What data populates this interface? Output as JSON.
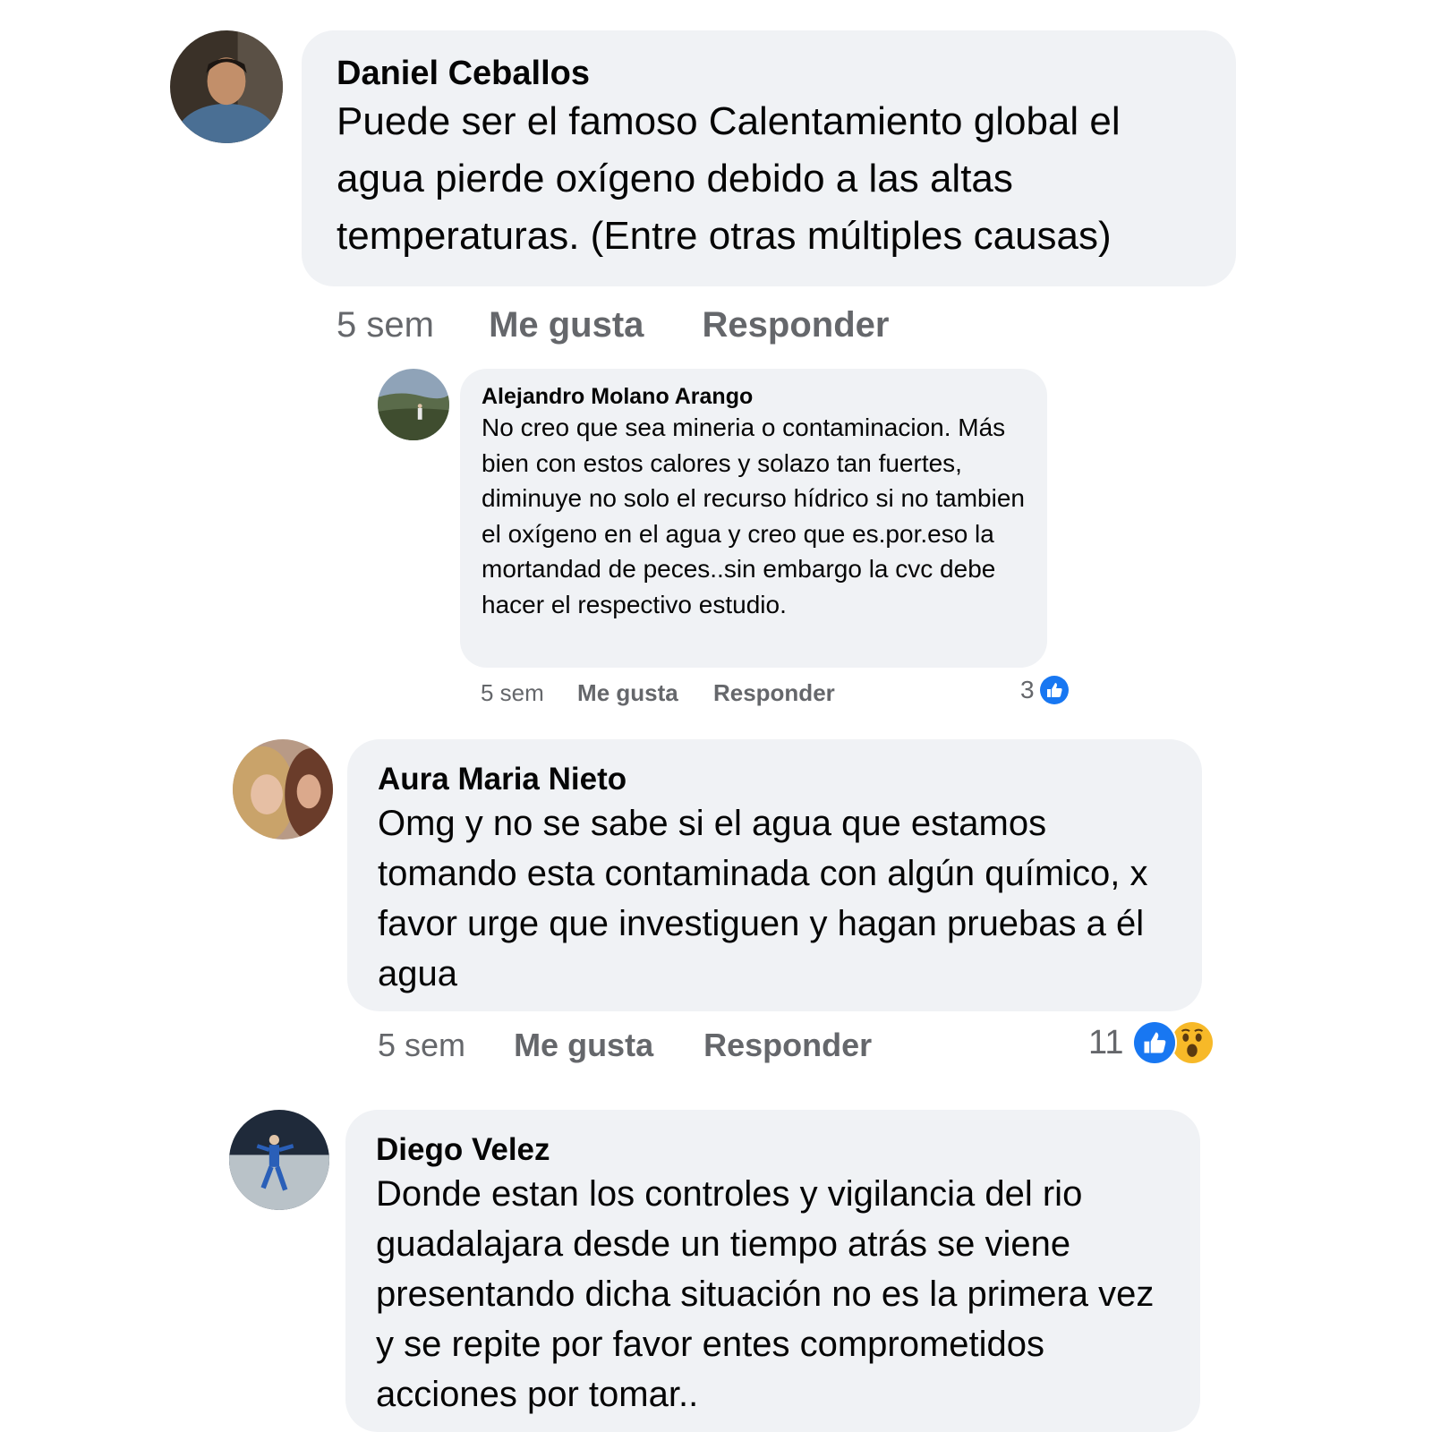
{
  "comments": [
    {
      "author": "Daniel Ceballos",
      "text": "Puede ser el famoso Calentamiento global el agua pierde oxígeno debido a las altas temperaturas. (Entre otras múltiples causas)",
      "time": "5 sem",
      "like_label": "Me gusta",
      "reply_label": "Responder",
      "avatar_icon": "profile-photo"
    },
    {
      "author": "Alejandro Molano Arango",
      "text": "No creo que sea mineria o contaminacion. Más bien con estos calores y solazo tan fuertes, diminuye no solo el recurso hídrico si no tambien el oxígeno en el agua y creo que es.por.eso la mortandad de peces..sin embargo la cvc debe hacer el respectivo estudio.",
      "time": "5 sem",
      "like_label": "Me gusta",
      "reply_label": "Responder",
      "reaction_count": "3",
      "reactions": [
        "like"
      ],
      "avatar_icon": "profile-photo-landscape"
    },
    {
      "author": "Aura Maria Nieto",
      "text": "Omg y no se sabe si el agua que estamos tomando esta contaminada con algún químico, x favor urge que investiguen y hagan pruebas a él agua",
      "time": "5 sem",
      "like_label": "Me gusta",
      "reply_label": "Responder",
      "reaction_count": "11",
      "reactions": [
        "like",
        "wow"
      ],
      "avatar_icon": "profile-photo"
    },
    {
      "author": "Diego Velez",
      "text": "Donde estan los controles y vigilancia del rio guadalajara desde un tiempo atrás se viene presentando dicha situación no es la primera vez y se repite por favor entes comprometidos acciones por tomar..",
      "avatar_icon": "profile-photo-soccer"
    }
  ],
  "colors": {
    "bubble": "#f0f2f5",
    "meta_text": "#65676b",
    "like_blue": "#1877f2",
    "wow_yellow": "#f7b928"
  }
}
